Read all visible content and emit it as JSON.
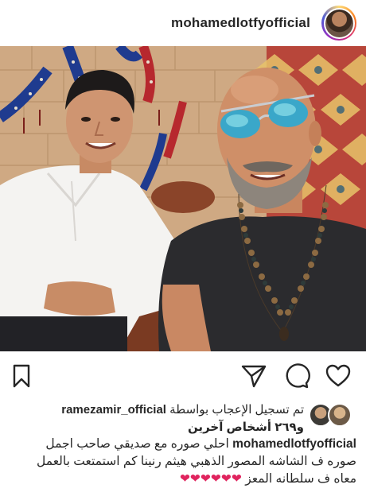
{
  "header": {
    "username": "mohamedlotfyofficial",
    "avatar_icon": "profile-avatar"
  },
  "post": {
    "image_alt": "",
    "actions": [
      "bookmark-icon",
      "send-icon",
      "comment-icon",
      "like-icon"
    ]
  },
  "likes": {
    "prefix": "تم تسجيل الإعجاب بواسطة",
    "user": "ramezamir_official",
    "others": "و٢٦٩ أشخاص آخرين"
  },
  "caption": {
    "username": "mohamedlotfyofficial",
    "text_line1": "احلي صوره مع صديقي صاحب اجمل",
    "text_line2": "صوره ف الشاشه المصور الذهبي هيثم رنينا كم استمتعت بالعمل",
    "text_line3": "معاه ف سلطانه المعز",
    "hearts": "❤❤❤❤❤❤"
  },
  "colors": {
    "text": "#262626",
    "heart": "#e0245e",
    "border": "#dbdbdb"
  }
}
